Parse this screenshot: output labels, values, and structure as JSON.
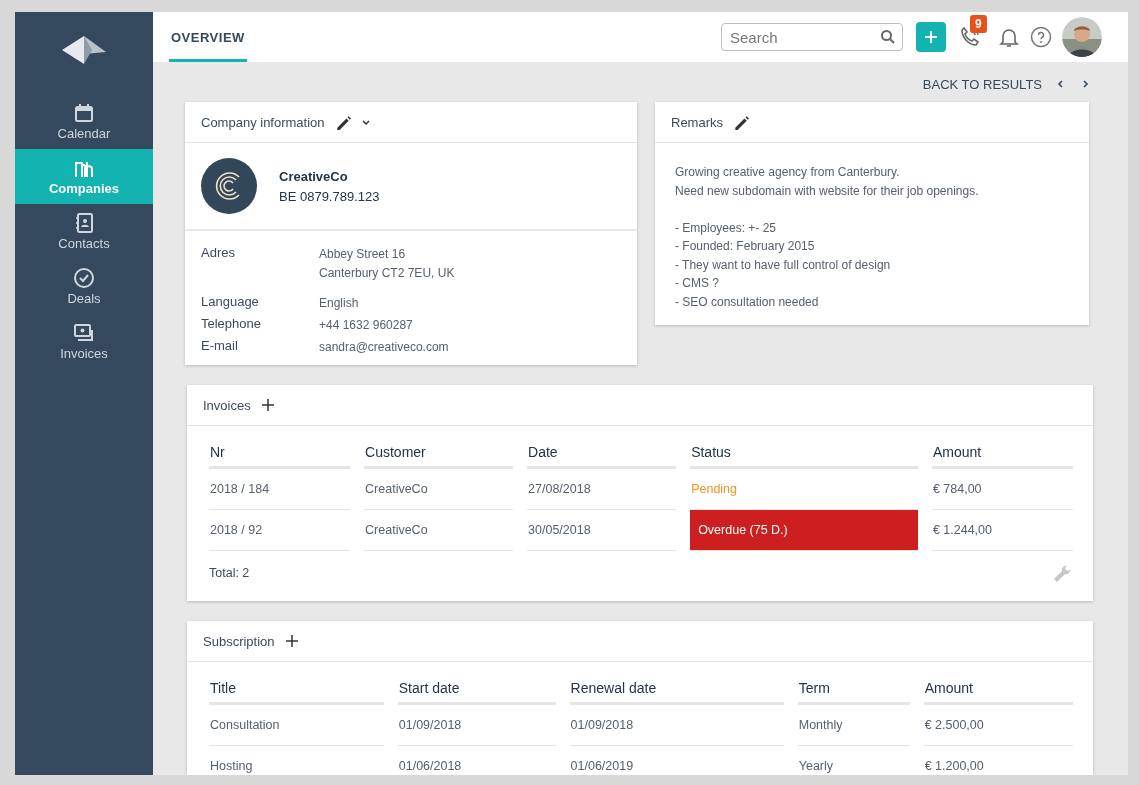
{
  "sidebar": {
    "items": [
      {
        "label": "Calendar",
        "selected": false
      },
      {
        "label": "Companies",
        "selected": true
      },
      {
        "label": "Contacts",
        "selected": false
      },
      {
        "label": "Deals",
        "selected": false
      },
      {
        "label": "Invoices",
        "selected": false
      }
    ]
  },
  "topbar": {
    "tabs": [
      {
        "label": "OVERVIEW",
        "selected": true
      }
    ],
    "search": {
      "placeholder": "Search"
    },
    "calls_badge": "9"
  },
  "navigation": {
    "back": "BACK TO RESULTS"
  },
  "company_card": {
    "title": "Company information",
    "name": "CreativeCo",
    "vat": "BE 0879.789.123",
    "fields": [
      {
        "label": "Adres",
        "lines": [
          "Abbey Street 16",
          "Canterbury CT2 7EU, UK"
        ]
      },
      {
        "label": "Language",
        "lines": [
          "English"
        ]
      },
      {
        "label": "Telephone",
        "lines": [
          "+44 1632 960287"
        ]
      },
      {
        "label": "E-mail",
        "lines": [
          "sandra@creativeco.com"
        ]
      }
    ]
  },
  "remarks_card": {
    "title": "Remarks",
    "paragraphs": [
      [
        "Growing creative agency from Canterbury.",
        "Need new subdomain with website for their job openings."
      ],
      [
        "- Employees: +- 25",
        "- Founded: February 2015",
        "- They want to have full control of design",
        "- CMS ?",
        "- SEO consultation needed"
      ]
    ]
  },
  "invoices": {
    "title": "Invoices",
    "columns": [
      "Nr",
      "Customer",
      "Date",
      "Status",
      "Amount"
    ],
    "rows": [
      {
        "nr": "2018 / 184",
        "customer": "CreativeCo",
        "date": "27/08/2018",
        "status": {
          "text": "Pending",
          "kind": "pending"
        },
        "amount": "€ 784,00"
      },
      {
        "nr": "2018 / 92",
        "customer": "CreativeCo",
        "date": "30/05/2018",
        "status": {
          "text": "Overdue (75 D.)",
          "kind": "overdue"
        },
        "amount": "€ 1.244,00"
      }
    ],
    "total": "Total: 2"
  },
  "subscription": {
    "title": "Subscription",
    "columns": [
      "Title",
      "Start date",
      "Renewal date",
      "Term",
      "Amount"
    ],
    "rows": [
      [
        "Consultation",
        "01/09/2018",
        "01/09/2018",
        "Monthly",
        "€ 2.500,00"
      ],
      [
        "Hosting",
        "01/06/2018",
        "01/06/2019",
        "Yearly",
        "€ 1.200,00"
      ]
    ]
  }
}
